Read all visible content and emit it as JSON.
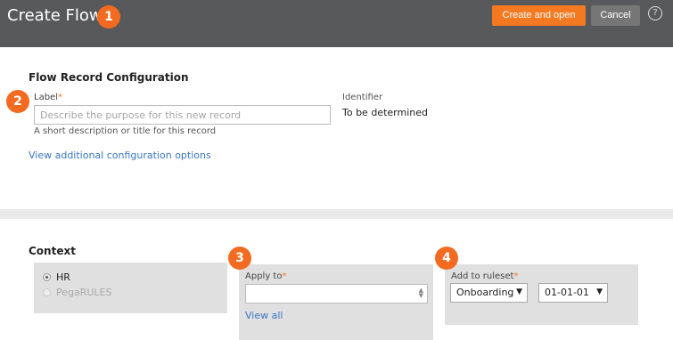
{
  "header": {
    "title": "Create Flow",
    "step_badge": "1",
    "create_button": "Create and open",
    "cancel_button": "Cancel",
    "help_icon": "?"
  },
  "config": {
    "section_title": "Flow Record Configuration",
    "step_badge": "2",
    "label_label": "Label",
    "label_placeholder": "Describe the purpose for this new record",
    "label_value": "",
    "label_helper": "A short description or title for this record",
    "identifier_label": "Identifier",
    "identifier_value": "To be determined",
    "more_options_link": "View additional configuration options"
  },
  "context": {
    "section_title": "Context",
    "options": [
      {
        "label": "HR",
        "selected": true,
        "disabled": false
      },
      {
        "label": "PegaRULES",
        "selected": false,
        "disabled": true
      }
    ],
    "apply_to": {
      "step_badge": "3",
      "label": "Apply to",
      "value": "",
      "view_all_link": "View all"
    },
    "ruleset": {
      "step_badge": "4",
      "label": "Add to ruleset",
      "ruleset_value": "Onboarding",
      "version_value": "01-01-01"
    }
  },
  "colors": {
    "header_bg": "#58595b",
    "accent": "#f47920",
    "link": "#3a75c4"
  },
  "icons": [
    "help-icon",
    "dropdown-arrow-icon",
    "stepper-icon"
  ]
}
